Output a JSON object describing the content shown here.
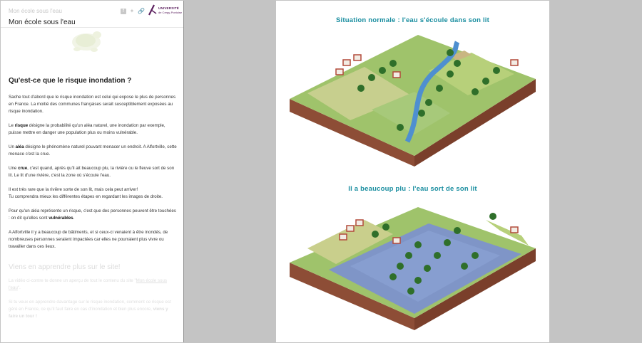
{
  "left": {
    "site_small": "Mon école sous l'eau",
    "site_title": "Mon école sous l'eau",
    "share_icons": [
      "facebook-icon",
      "twitter-icon",
      "link-icon"
    ],
    "logo": {
      "line1": "UNIVERSITÉ",
      "line2": "de Cergy-Pontoise"
    },
    "heading": "Qu'est-ce que le risque inondation ?",
    "p1": "Sache tout d'abord que le risque inondation est celui qui expose le plus de personnes en France. La moitié des communes françaises serait susceptiblement exposées au risque inondation.",
    "p2": {
      "a": "Le ",
      "b": "risque",
      "c": " désigne la probabilité qu'un aléa naturel, une inondation par exemple, puisse mettre en danger une population plus ou moins vulnérable."
    },
    "p3": {
      "a": "Un ",
      "b": "aléa",
      "c": " désigne le phénomène naturel pouvant menacer un endroit. A Alfortville, cette menace c'est la crue."
    },
    "p4": {
      "a": "Une ",
      "b": "crue",
      "c": ", c'est quand, après qu'il ait beaucoup plu, la rivière ou le fleuve sort de son lit. Le lit d'une rivière, c'est la zone où s'écoule l'eau."
    },
    "p5a": "Il est très rare que la rivière sorte de son lit, mais cela peut arriver!",
    "p5b": "Tu comprendra mieux les différentes étapes en regardant les images de droite.",
    "p6": {
      "a": "Pour qu'un aléa représente un risque, c'est que des personnes peuvent être touchées : on dit qu'elles sont ",
      "b": "vulnérables",
      "c": "."
    },
    "p7": "A Alfortville il y a beaucoup de bâtiments, et si ceux-ci venaient à être inondés, de nombreuses personnes seraient impactées car elles ne pourraient plus vivre ou travailler dans ces lieux.",
    "heading2": "Viens en apprendre plus sur le site!",
    "p8": {
      "a": "La vidéo ci-contre te donne un aperçu de tout le contenu du site \"",
      "link": "Mon école sous l'eau",
      "c": "\"."
    },
    "p9": {
      "a": "Si tu veux en apprendre davantage sur le risque inondation, comment ce risque est géré en France, ce qu'il faut faire en cas d'inondation et bien plus encore, ",
      "b": "viens y faire un tour !"
    }
  },
  "right": {
    "caption1": "Situation normale : l'eau s'écoule dans son lit",
    "caption2": "Il a beaucoup plu : l'eau sort de son lit"
  }
}
